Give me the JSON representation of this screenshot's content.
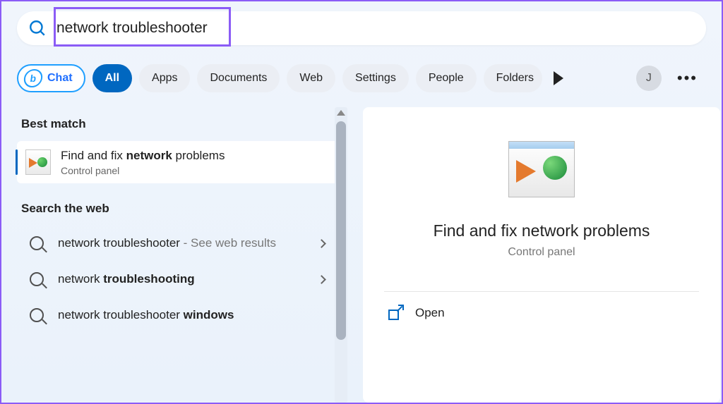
{
  "search": {
    "value": "network troubleshooter"
  },
  "filters": {
    "chat": "Chat",
    "all": "All",
    "apps": "Apps",
    "documents": "Documents",
    "web": "Web",
    "settings": "Settings",
    "people": "People",
    "folders": "Folders"
  },
  "user": {
    "initial": "J"
  },
  "left": {
    "best_match_header": "Best match",
    "best_result": {
      "title_pre": "Find and fix ",
      "title_bold": "network",
      "title_post": " problems",
      "subtitle": "Control panel"
    },
    "web_header": "Search the web",
    "web_items": [
      {
        "main": "network troubleshooter",
        "bold": "",
        "suffix": " - See web results"
      },
      {
        "main": "network ",
        "bold": "troubleshooting",
        "suffix": ""
      },
      {
        "main": "network troubleshooter ",
        "bold": "windows",
        "suffix": ""
      }
    ]
  },
  "preview": {
    "title": "Find and fix network problems",
    "subtitle": "Control panel",
    "action_open": "Open"
  }
}
